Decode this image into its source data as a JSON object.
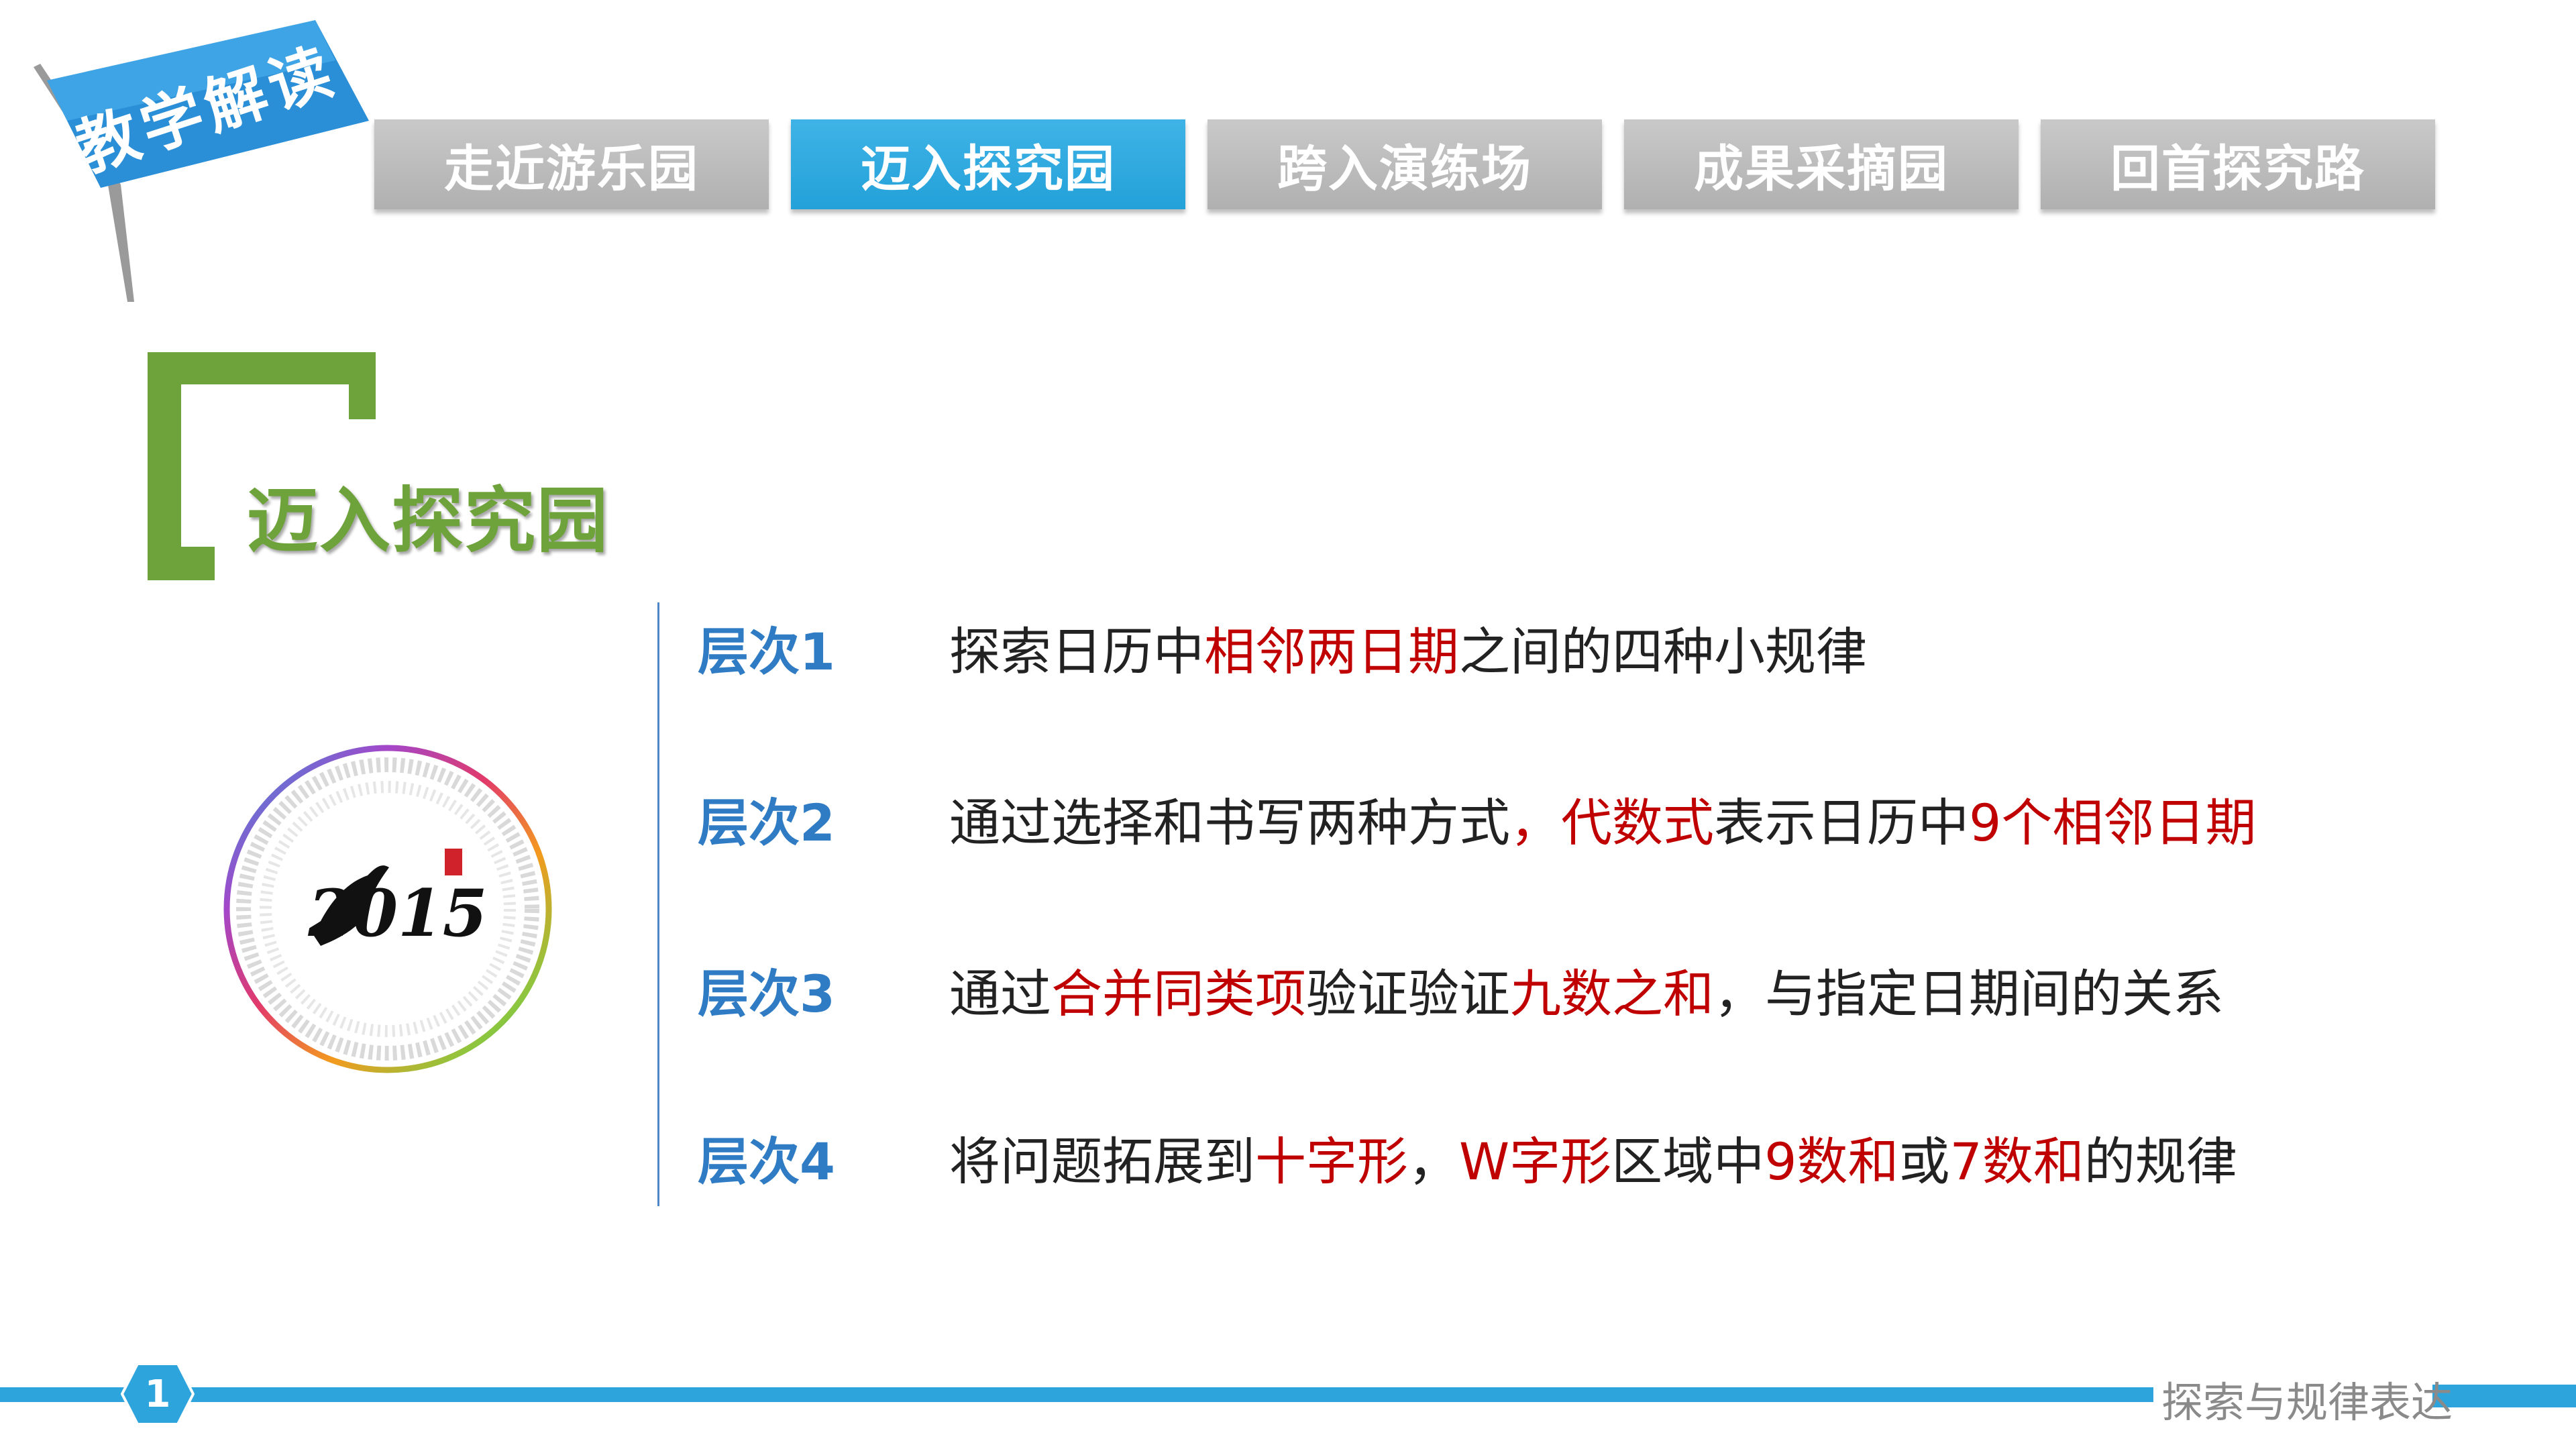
{
  "ribbon": {
    "label": "教学解读"
  },
  "tabs": [
    {
      "label": "走近游乐园",
      "active": false
    },
    {
      "label": "迈入探究园",
      "active": true
    },
    {
      "label": "跨入演练场",
      "active": false
    },
    {
      "label": "成果采摘园",
      "active": false
    },
    {
      "label": "回首探究路",
      "active": false
    }
  ],
  "section": {
    "title": "迈入探究园"
  },
  "calendar": {
    "year": "2015"
  },
  "levels": [
    {
      "label": "层次1",
      "parts": [
        "探索日历中",
        "相邻两日期",
        "之间的四种小规律"
      ]
    },
    {
      "label": "层次2",
      "parts": [
        "通过选择和书写两种方式",
        "，代数式",
        "表示日历中",
        "9个相邻日期"
      ]
    },
    {
      "label": "层次3",
      "parts": [
        "通过",
        "合并同类项",
        "验证验证",
        "九数之和",
        "，与指定日期间的关系"
      ]
    },
    {
      "label": "层次4",
      "parts": [
        "将问题拓展到",
        "十字形",
        "，",
        "W字形",
        "区域中",
        "9数和",
        "或",
        "7数和",
        "的规律"
      ]
    }
  ],
  "footer": {
    "page": "1",
    "caption": "探索与规律表达"
  },
  "colors": {
    "tab_active": "#2ea4dd",
    "tab_inactive": "#bdbdbd",
    "section_green": "#6ea23b",
    "level_blue": "#2f7bc4",
    "highlight_red": "#c00000",
    "footer_bar": "#2ea4dd"
  }
}
